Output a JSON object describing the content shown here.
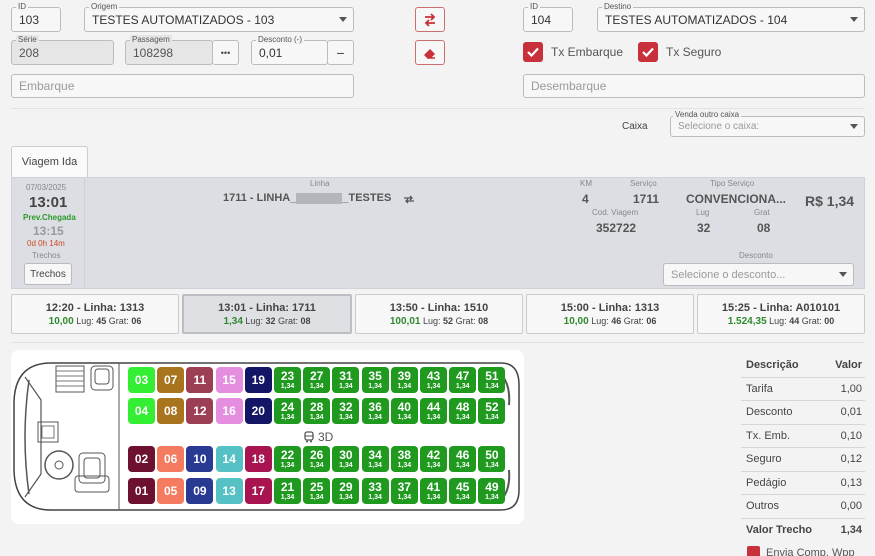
{
  "origem": {
    "id_label": "ID",
    "id_value": "103",
    "label": "Origem",
    "value": "TESTES AUTOMATIZADOS - 103"
  },
  "destino": {
    "id_label": "ID",
    "id_value": "104",
    "label": "Destino",
    "value": "TESTES AUTOMATIZADOS - 104"
  },
  "serie": {
    "label": "Série",
    "value": "208"
  },
  "passagem": {
    "label": "Passagem",
    "value": "108298",
    "dots": "•••"
  },
  "desconto_field": {
    "label": "Desconto (-)",
    "value": "0,01",
    "minus": "−"
  },
  "taxas": {
    "embarque": "Tx Embarque",
    "seguro": "Tx Seguro"
  },
  "embarque_placeholder": "Embarque",
  "desembarque_placeholder": "Desembarque",
  "caixa": {
    "label": "Caixa",
    "venda_label": "Venda outro caixa",
    "placeholder": "Selecione o caixa:"
  },
  "tab_label": "Viagem Ida",
  "trip": {
    "date": "07/03/2025",
    "time": "13:01",
    "prev_label": "Prev.Chegada",
    "arrival": "13:15",
    "duration": "0d 0h 14m",
    "trechos_label": "Trechos",
    "trechos_button": "Trechos",
    "linha_label": "Linha",
    "linha_value": "1711 - LINHA_",
    "linha_suffix": "_TESTES",
    "km_label": "KM",
    "km_value": "4",
    "servico_label": "Serviço",
    "servico_value": "1711",
    "tipo_label": "Tipo Serviço",
    "tipo_value": "CONVENCIONA...",
    "price": "R$ 1,34",
    "cod_label": "Cod. Viagem",
    "cod_value": "352722",
    "lug_label": "Lug",
    "lug_value": "32",
    "grat_label": "Grat",
    "grat_value": "08",
    "desconto_label": "Desconto",
    "desconto_placeholder": "Selecione o desconto..."
  },
  "trips": [
    {
      "title": "12:20 - Linha: 1313",
      "price": "10,00",
      "lug": "45",
      "grat": "06",
      "active": false
    },
    {
      "title": "13:01 - Linha: 1711",
      "price": "1,34",
      "lug": "32",
      "grat": "08",
      "active": true
    },
    {
      "title": "13:50 - Linha: 1510",
      "price": "100,01",
      "lug": "52",
      "grat": "08",
      "active": false
    },
    {
      "title": "15:00 - Linha: 1313",
      "price": "10,00",
      "lug": "46",
      "grat": "06",
      "active": false
    },
    {
      "title": "15:25 - Linha: A010101",
      "price": "1.524,35",
      "lug": "44",
      "grat": "00",
      "active": false
    }
  ],
  "trip_lug_label": "Lug:",
  "trip_grat_label": "Grat:",
  "deck_label": "3D",
  "seat_price": "1,34",
  "seat_colors": {
    "available": "#1f9a1f"
  },
  "special_seats": [
    {
      "num": "03",
      "color": "#33ee33"
    },
    {
      "num": "04",
      "color": "#33ee33"
    },
    {
      "num": "07",
      "color": "#a8741e"
    },
    {
      "num": "08",
      "color": "#a8741e"
    },
    {
      "num": "11",
      "color": "#9c3f55"
    },
    {
      "num": "12",
      "color": "#9c3f55"
    },
    {
      "num": "15",
      "color": "#e58ee0"
    },
    {
      "num": "16",
      "color": "#e58ee0"
    },
    {
      "num": "19",
      "color": "#151566"
    },
    {
      "num": "20",
      "color": "#151566"
    },
    {
      "num": "02",
      "color": "#6e1130"
    },
    {
      "num": "01",
      "color": "#6e1130"
    },
    {
      "num": "06",
      "color": "#f47a60"
    },
    {
      "num": "05",
      "color": "#f47a60"
    },
    {
      "num": "10",
      "color": "#283a92"
    },
    {
      "num": "09",
      "color": "#283a92"
    },
    {
      "num": "14",
      "color": "#56c1c4"
    },
    {
      "num": "13",
      "color": "#56c1c4"
    },
    {
      "num": "18",
      "color": "#a8144f"
    },
    {
      "num": "17",
      "color": "#a8144f"
    }
  ],
  "seat_rows": [
    [
      "03",
      "07",
      "11",
      "15",
      "19",
      "23",
      "27",
      "31",
      "35",
      "39",
      "43",
      "47",
      "51"
    ],
    [
      "04",
      "08",
      "12",
      "16",
      "20",
      "24",
      "28",
      "32",
      "36",
      "40",
      "44",
      "48",
      "52"
    ],
    [
      "02",
      "06",
      "10",
      "14",
      "18",
      "22",
      "26",
      "30",
      "34",
      "38",
      "42",
      "46",
      "50"
    ],
    [
      "01",
      "05",
      "09",
      "13",
      "17",
      "21",
      "25",
      "29",
      "33",
      "37",
      "41",
      "45",
      "49"
    ]
  ],
  "summary": {
    "head_desc": "Descrição",
    "head_val": "Valor",
    "rows": [
      {
        "label": "Tarifa",
        "value": "1,00"
      },
      {
        "label": "Desconto",
        "value": "0,01"
      },
      {
        "label": "Tx. Emb.",
        "value": "0,10"
      },
      {
        "label": "Seguro",
        "value": "0,12"
      },
      {
        "label": "Pedágio",
        "value": "0,13"
      },
      {
        "label": "Outros",
        "value": "0,00"
      }
    ],
    "total_label": "Valor Trecho",
    "total_value": "1,34"
  },
  "envia_label": "Envia Comp. Wpp"
}
